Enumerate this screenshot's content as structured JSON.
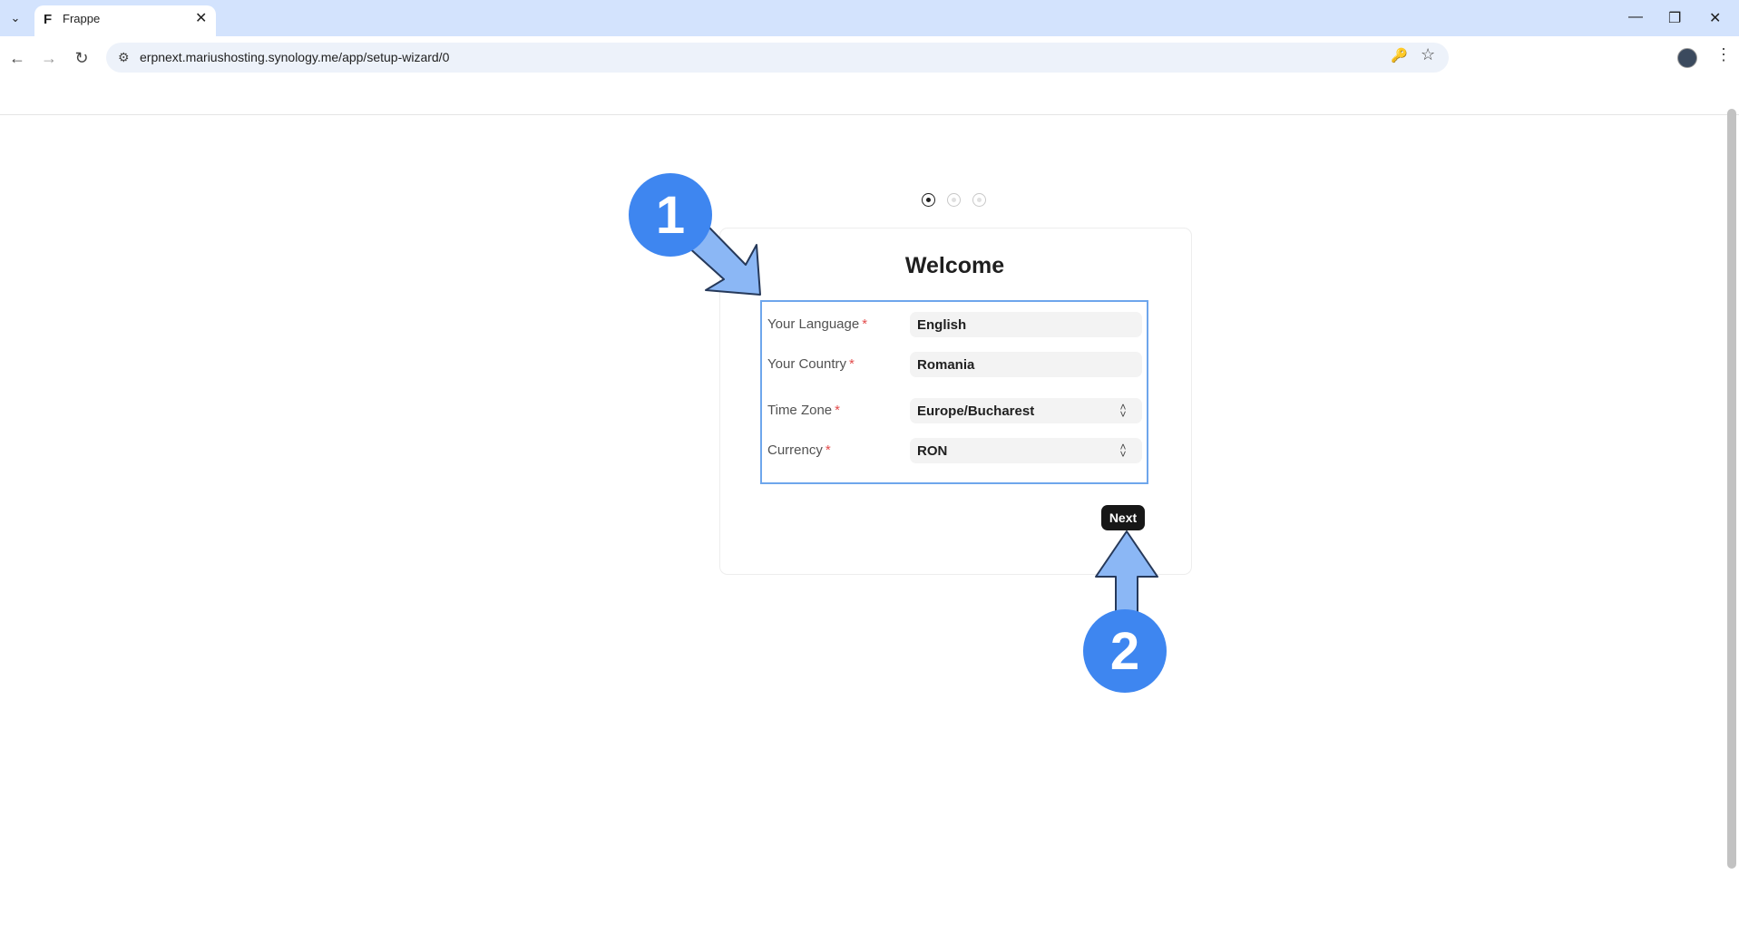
{
  "browser": {
    "tab_title": "Frappe",
    "tab_favicon": "F",
    "url": "erpnext.mariushosting.synology.me/app/setup-wizard/0"
  },
  "wizard": {
    "title": "Welcome",
    "steps": 3,
    "active_step": 1,
    "fields": [
      {
        "label": "Your Language",
        "value": "English",
        "type": "input"
      },
      {
        "label": "Your Country",
        "value": "Romania",
        "type": "input"
      },
      {
        "label": "Time Zone",
        "value": "Europe/Bucharest",
        "type": "select"
      },
      {
        "label": "Currency",
        "value": "RON",
        "type": "select"
      }
    ],
    "required_marker": "*",
    "next_label": "Next"
  },
  "annotations": {
    "badge_1": "1",
    "badge_2": "2",
    "accent_color": "#3e86f0"
  }
}
